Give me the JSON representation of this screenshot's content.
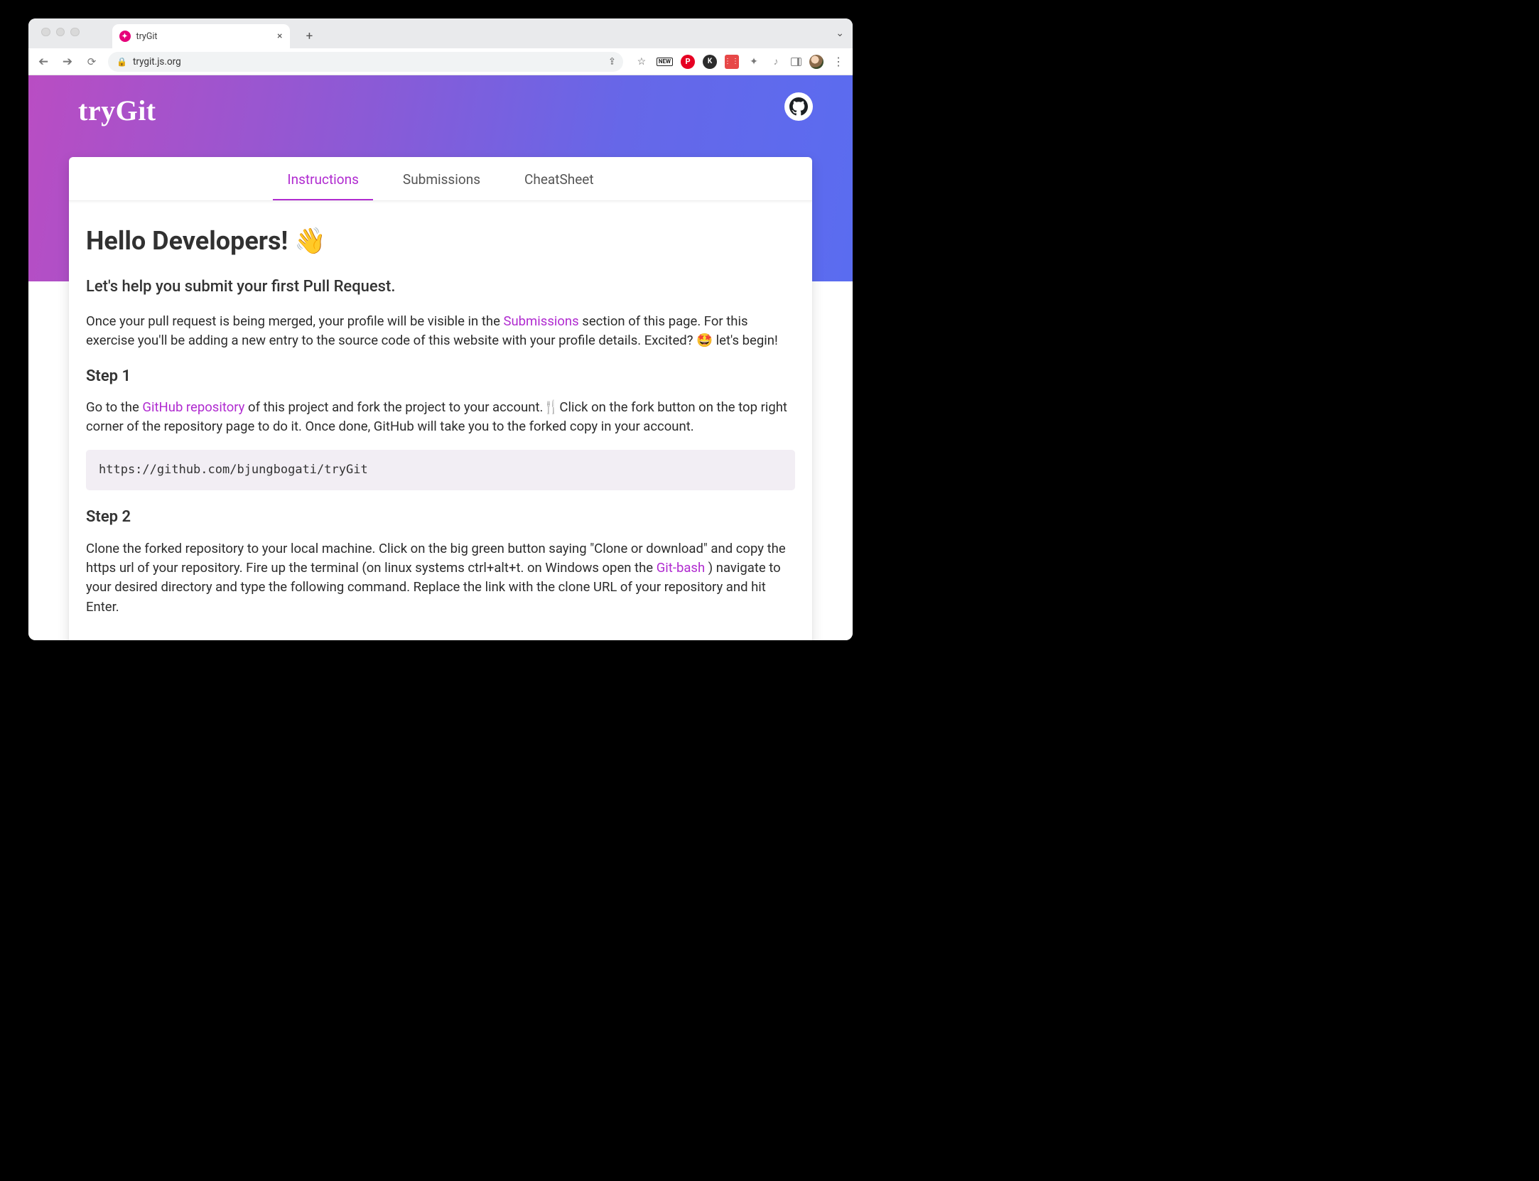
{
  "browser": {
    "tab_title": "tryGit",
    "url_display": "trygit.js.org",
    "ext_new_label": "NEW"
  },
  "page": {
    "brand": "tryGit",
    "tabs": [
      {
        "label": "Instructions",
        "active": true
      },
      {
        "label": "Submissions",
        "active": false
      },
      {
        "label": "CheatSheet",
        "active": false
      }
    ],
    "heading": "Hello Developers! 👋",
    "subheading": "Let's help you submit your first Pull Request.",
    "intro_pre": "Once your pull request is being merged, your profile will be visible in the ",
    "intro_link": "Submissions",
    "intro_post": " section of this page. For this exercise you'll be adding a new entry to the source code of this website with your profile details. Excited? 🤩 let's begin!",
    "step1_title": "Step 1",
    "step1_pre": "Go to the ",
    "step1_link": "GitHub repository",
    "step1_post": " of this project and fork the project to your account.🍴Click on the fork button on the top right corner of the repository page to do it. Once done, GitHub will take you to the forked copy in your account.",
    "step1_code": "https://github.com/bjungbogati/tryGit",
    "step2_title": "Step 2",
    "step2_pre": "Clone the forked repository to your local machine. Click on the big green button saying \"Clone or download\" and copy the https url of your repository. Fire up the terminal (on linux systems ctrl+alt+t. on Windows open the ",
    "step2_link": "Git-bash",
    "step2_post": " ) navigate to your desired directory and type the following command. Replace the link with the clone URL of your repository and hit Enter."
  }
}
